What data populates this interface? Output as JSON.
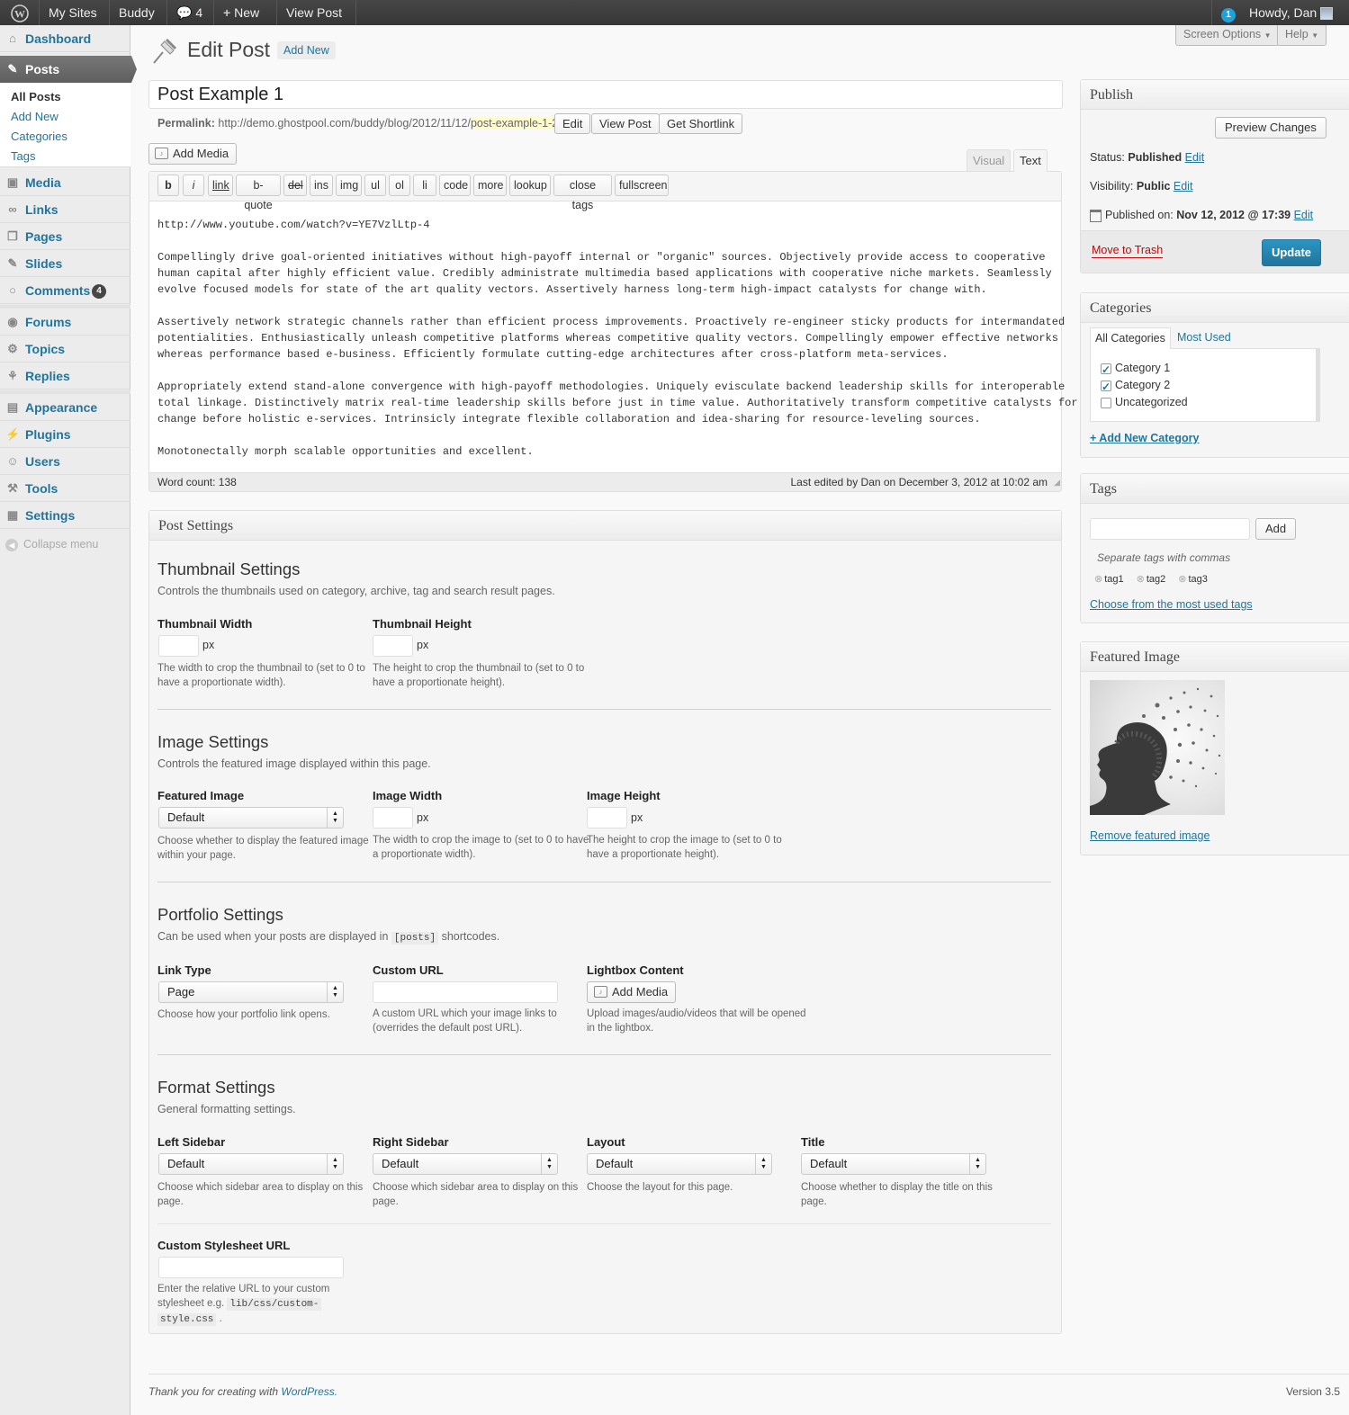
{
  "adminbar": {
    "my_sites": "My Sites",
    "site": "Buddy",
    "comments_count": "4",
    "new": "New",
    "view_post": "View Post",
    "updates": "1",
    "howdy": "Howdy, Dan"
  },
  "sidebar": {
    "dashboard": "Dashboard",
    "posts": "Posts",
    "posts_sub": [
      "All Posts",
      "Add New",
      "Categories",
      "Tags"
    ],
    "media": "Media",
    "links": "Links",
    "pages": "Pages",
    "slides": "Slides",
    "comments": "Comments",
    "comments_badge": "4",
    "forums": "Forums",
    "topics": "Topics",
    "replies": "Replies",
    "appearance": "Appearance",
    "plugins": "Plugins",
    "users": "Users",
    "tools": "Tools",
    "settings": "Settings",
    "collapse": "Collapse menu"
  },
  "header": {
    "title": "Edit Post",
    "add_new": "Add New",
    "screen_options": "Screen Options",
    "help": "Help"
  },
  "post": {
    "title": "Post Example 1",
    "permalink_label": "Permalink:",
    "permalink_base": "http://demo.ghostpool.com/buddy/blog/2012/11/12/",
    "permalink_slug": "post-example-1-2",
    "permalink_end": "/",
    "edit": "Edit",
    "view_post": "View Post",
    "get_shortlink": "Get Shortlink",
    "add_media": "Add Media",
    "tab_visual": "Visual",
    "tab_text": "Text"
  },
  "quicktags": [
    "b",
    "i",
    "link",
    "b-quote",
    "del",
    "ins",
    "img",
    "ul",
    "ol",
    "li",
    "code",
    "more",
    "lookup",
    "close tags",
    "fullscreen"
  ],
  "content": {
    "p0": "http://www.youtube.com/watch?v=YE7VzlLtp-4",
    "p1": [
      "Compellingly drive goal-oriented initiatives without high-payoff internal or \"organic\" sources. Objectively provide access to cooperative",
      "human capital after highly efficient value. Credibly administrate multimedia based applications with cooperative niche markets. Seamlessly",
      "evolve focused models for state of the art quality vectors. Assertively harness long-term high-impact catalysts for change with."
    ],
    "p2": [
      "Assertively network strategic channels rather than efficient process improvements. Proactively re-engineer sticky products for intermandated",
      "potentialities. Enthusiastically unleash competitive platforms whereas competitive quality vectors. Compellingly empower effective networks",
      "whereas performance based e-business. Efficiently formulate cutting-edge architectures after cross-platform meta-services."
    ],
    "p3": [
      "Appropriately extend stand-alone convergence with high-payoff methodologies. Uniquely evisculate backend leadership skills for interoperable",
      "total linkage. Distinctively matrix real-time leadership skills before just in time value. Authoritatively transform competitive catalysts for",
      "change before holistic e-services. Intrinsicly integrate flexible collaboration and idea-sharing for resource-leveling sources."
    ],
    "p4": "Monotonectally morph scalable opportunities and excellent.",
    "word_count": "Word count: 138",
    "last_edited": "Last edited by Dan on December 3, 2012 at 10:02 am"
  },
  "settings": {
    "title": "Post Settings",
    "thumb": {
      "heading": "Thumbnail Settings",
      "desc": "Controls the thumbnails used on category, archive, tag and search result pages.",
      "w_label": "Thumbnail Width",
      "w_desc": [
        "The width to crop the thumbnail to (set to 0 to",
        "have a proportionate width)."
      ],
      "h_label": "Thumbnail Height",
      "h_desc": [
        "The height to crop the thumbnail to (set to 0 to",
        "have a proportionate height)."
      ],
      "px": "px"
    },
    "image": {
      "heading": "Image Settings",
      "desc": "Controls the featured image displayed within this page.",
      "fi_label": "Featured Image",
      "fi_value": "Default",
      "fi_desc": [
        "Choose whether to display the featured image",
        "within your page."
      ],
      "w_label": "Image Width",
      "w_desc": [
        "The width to crop the image to (set to 0 to have",
        "a proportionate width)."
      ],
      "h_label": "Image Height",
      "h_desc": [
        "The height to crop the image to (set to 0 to",
        "have a proportionate height)."
      ]
    },
    "portfolio": {
      "heading": "Portfolio Settings",
      "desc_a": "Can be used when your posts are displayed in",
      "desc_code": "[posts]",
      "desc_b": "shortcodes.",
      "lt_label": "Link Type",
      "lt_value": "Page",
      "lt_desc": "Choose how your portfolio link opens.",
      "cu_label": "Custom URL",
      "cu_desc": [
        "A custom URL which your image links to",
        "(overrides the default post URL)."
      ],
      "lb_label": "Lightbox Content",
      "lb_button": "Add Media",
      "lb_desc": [
        "Upload images/audio/videos that will be opened",
        "in the lightbox."
      ]
    },
    "format": {
      "heading": "Format Settings",
      "desc": "General formatting settings.",
      "ls_label": "Left Sidebar",
      "ls_value": "Default",
      "ls_desc": [
        "Choose which sidebar area to display on this",
        "page."
      ],
      "rs_label": "Right Sidebar",
      "rs_value": "Default",
      "rs_desc": [
        "Choose which sidebar area to display on this",
        "page."
      ],
      "lay_label": "Layout",
      "lay_value": "Default",
      "lay_desc": "Choose the layout for this page.",
      "t_label": "Title",
      "t_value": "Default",
      "t_desc": [
        "Choose whether to display the title on this",
        "page."
      ],
      "css_label": "Custom Stylesheet URL",
      "css_desc_a": "Enter the relative URL to your custom",
      "css_desc_b": "stylesheet e.g.",
      "css_code1": "lib/css/custom-",
      "css_code2": "style.css",
      "css_end": "."
    }
  },
  "publish": {
    "title": "Publish",
    "preview": "Preview Changes",
    "status_label": "Status:",
    "status": "Published",
    "visibility_label": "Visibility:",
    "visibility": "Public",
    "published_label": "Published on:",
    "published": "Nov 12, 2012 @ 17:39",
    "edit": "Edit",
    "trash": "Move to Trash",
    "update": "Update"
  },
  "categories": {
    "title": "Categories",
    "tab_all": "All Categories",
    "tab_used": "Most Used",
    "items": [
      {
        "label": "Category 1",
        "checked": true
      },
      {
        "label": "Category 2",
        "checked": true
      },
      {
        "label": "Uncategorized",
        "checked": false
      }
    ],
    "add_new": "+ Add New Category"
  },
  "tags": {
    "title": "Tags",
    "add": "Add",
    "hint": "Separate tags with commas",
    "items": [
      "tag1",
      "tag2",
      "tag3"
    ],
    "choose": "Choose from the most used tags"
  },
  "featured": {
    "title": "Featured Image",
    "remove": "Remove featured image"
  },
  "footer": {
    "thanks": "Thank you for creating with",
    "wp": "WordPress.",
    "version": "Version 3.5"
  }
}
